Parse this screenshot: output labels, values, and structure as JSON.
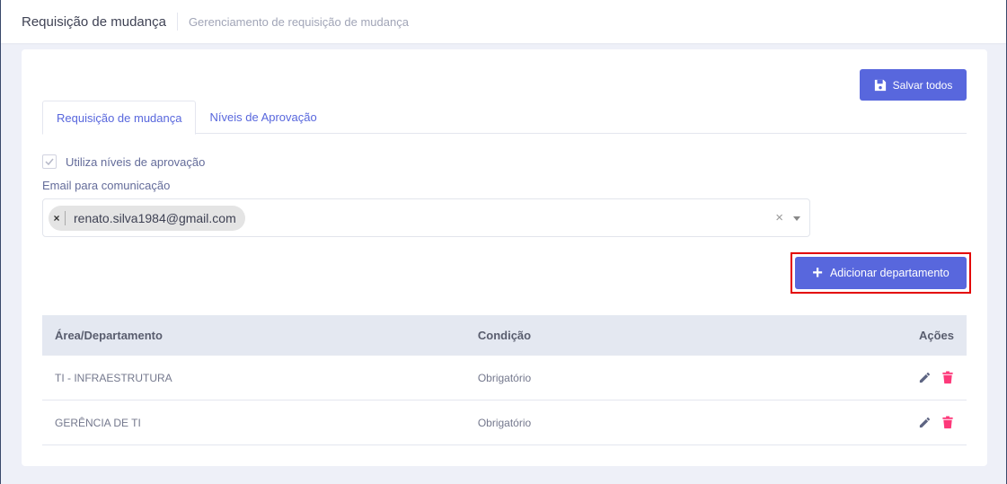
{
  "header": {
    "title": "Requisição de mudança",
    "subtitle": "Gerenciamento de requisição de mudança"
  },
  "toolbar": {
    "save_all_label": "Salvar todos",
    "save_icon": "floppy-disk-icon"
  },
  "tabs": [
    {
      "label": "Requisição de mudança",
      "active": true
    },
    {
      "label": "Níveis de Aprovação",
      "active": false
    }
  ],
  "form": {
    "approval_levels_label": "Utiliza níveis de aprovação",
    "approval_levels_checked": true,
    "email_label": "Email para comunicação",
    "emails": [
      "renato.silva1984@gmail.com"
    ],
    "chip_remove": "×",
    "clear_all": "×"
  },
  "add_department": {
    "label": "Adicionar departamento",
    "icon": "+"
  },
  "table": {
    "headers": {
      "area": "Área/Departamento",
      "condition": "Condição",
      "actions": "Ações"
    },
    "rows": [
      {
        "area": "TI - INFRAESTRUTURA",
        "condition": "Obrigatório"
      },
      {
        "area": "GERÊNCIA DE TI",
        "condition": "Obrigatório"
      }
    ]
  },
  "colors": {
    "primary": "#5867dd",
    "highlight": "#e30000",
    "edit_icon": "#5d6482",
    "delete_icon": "#fd397a"
  }
}
